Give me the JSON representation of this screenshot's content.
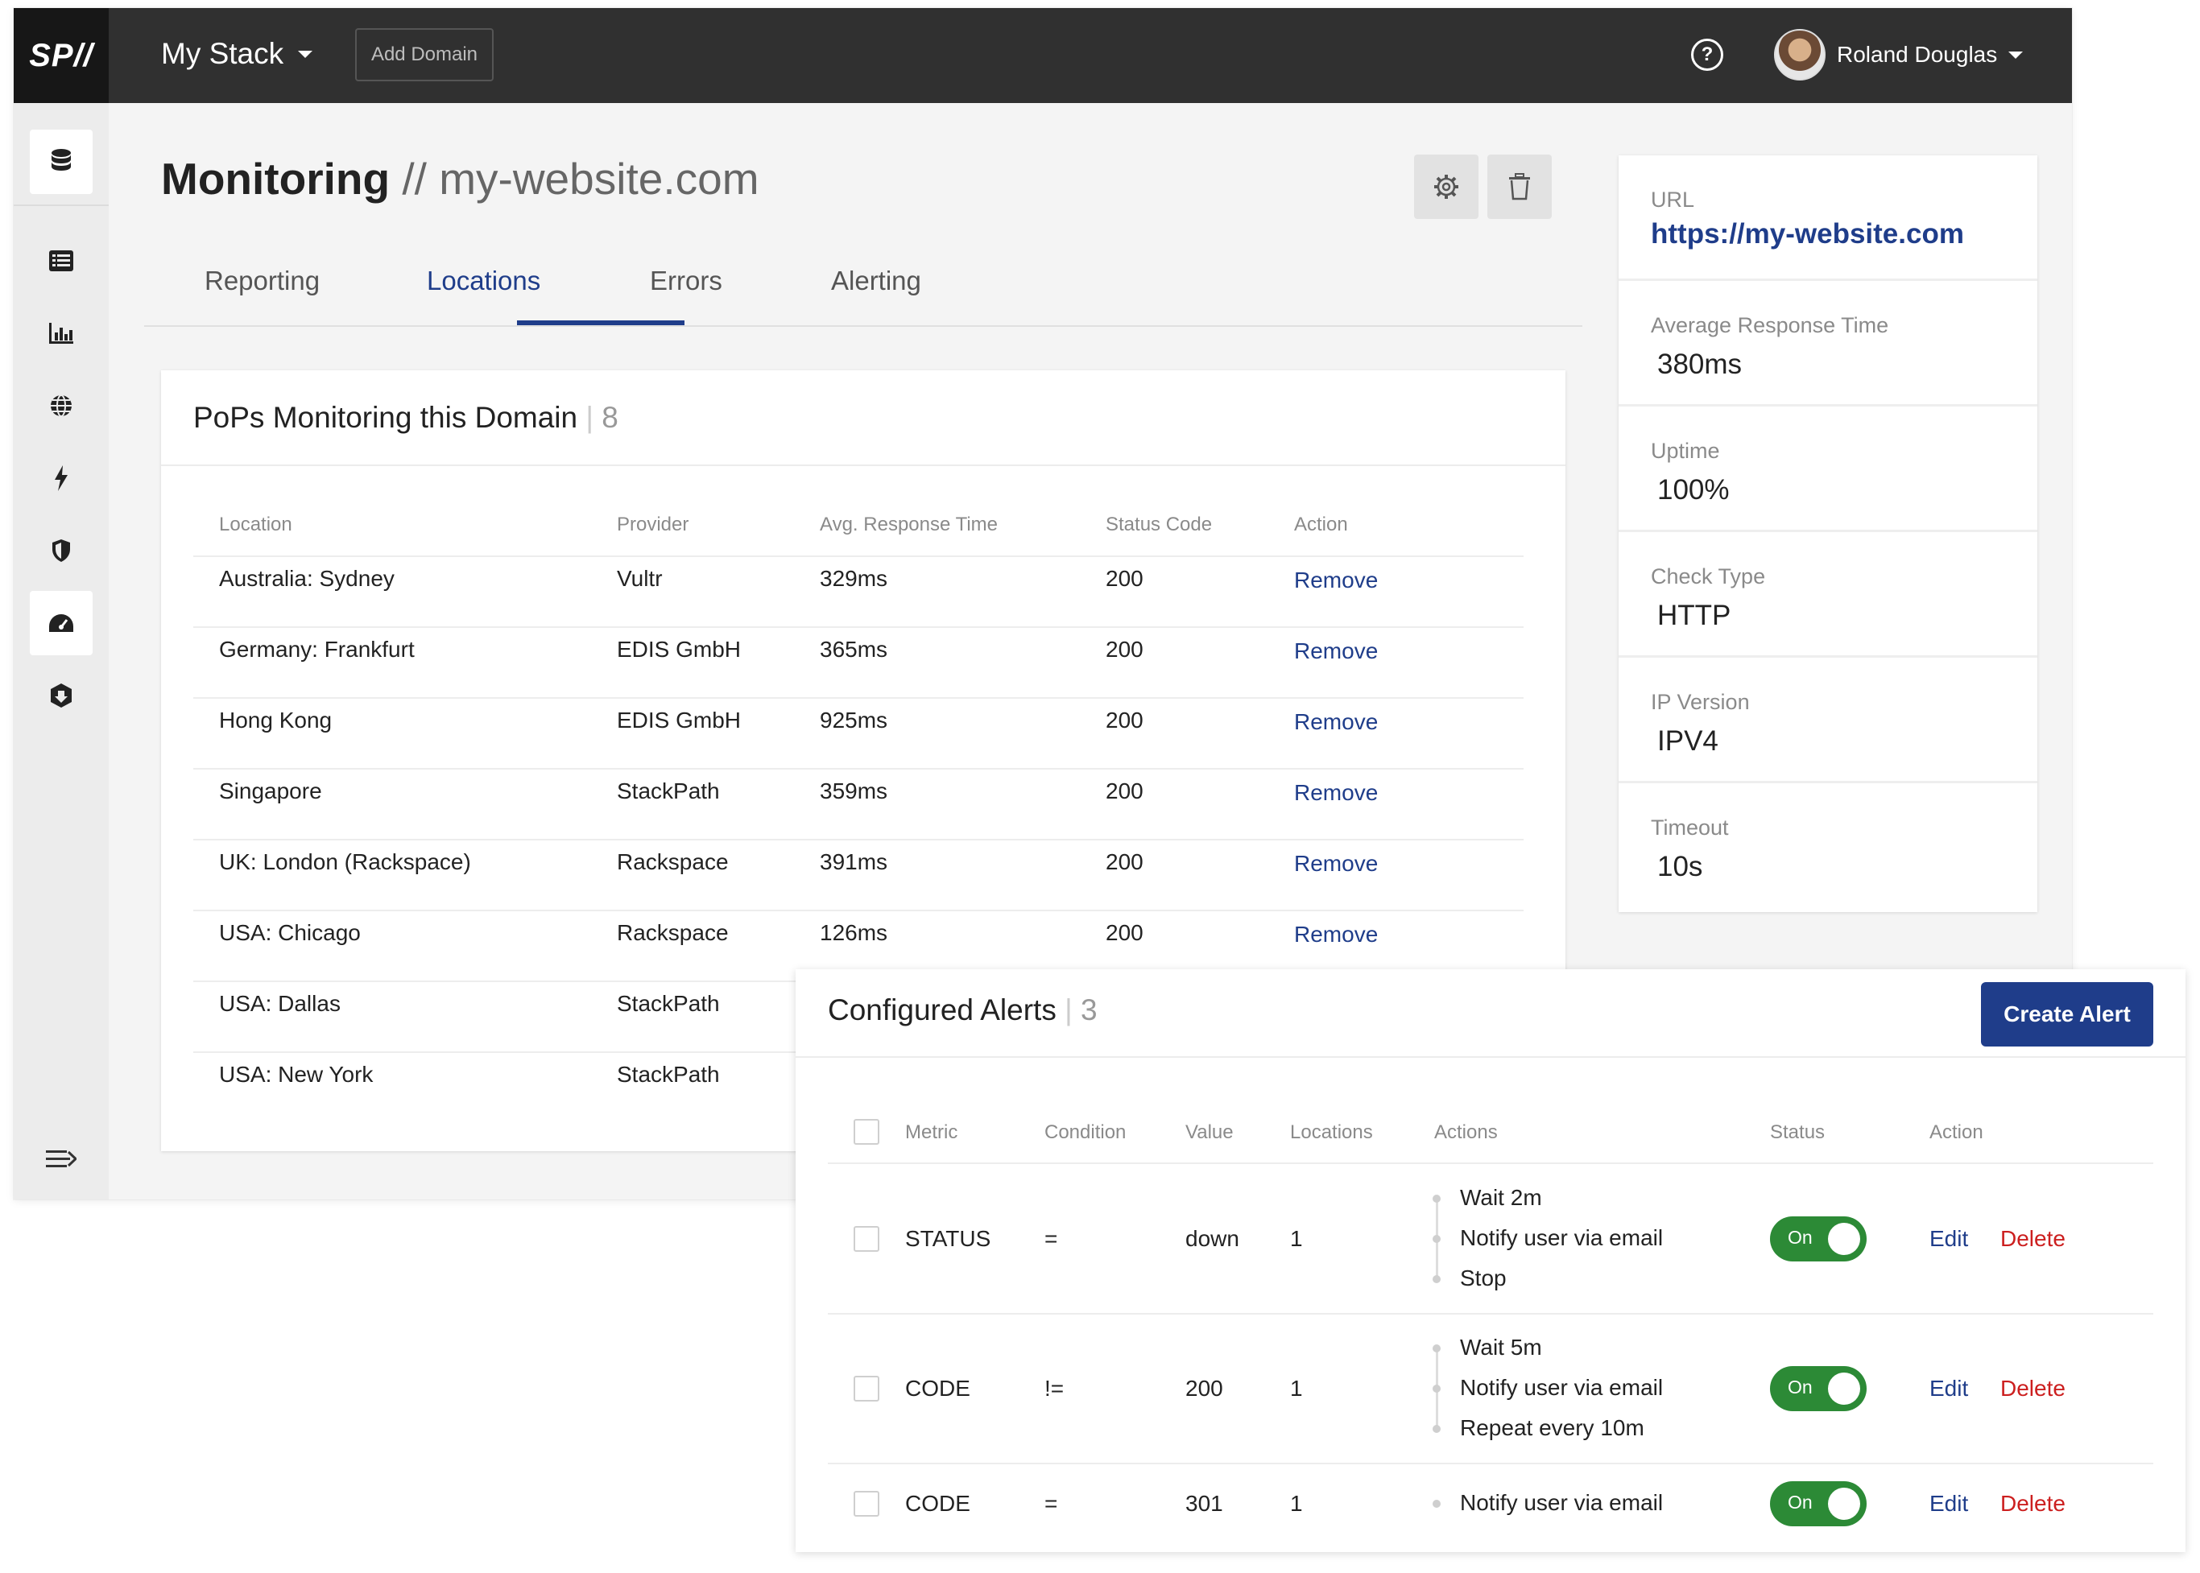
{
  "topbar": {
    "logo": "SP//",
    "stack_name": "My Stack",
    "add_domain": "Add Domain",
    "help": "?",
    "user_name": "Roland Douglas"
  },
  "page": {
    "title": "Monitoring",
    "separator": "//",
    "domain": "my-website.com"
  },
  "tabs": [
    "Reporting",
    "Locations",
    "Errors",
    "Alerting"
  ],
  "active_tab": "Locations",
  "pops": {
    "title": "PoPs Monitoring this Domain",
    "count": "8",
    "columns": [
      "Location",
      "Provider",
      "Avg. Response Time",
      "Status Code",
      "Action"
    ],
    "rows": [
      {
        "location": "Australia: Sydney",
        "provider": "Vultr",
        "time": "329ms",
        "code": "200",
        "action": "Remove"
      },
      {
        "location": "Germany: Frankfurt",
        "provider": "EDIS GmbH",
        "time": "365ms",
        "code": "200",
        "action": "Remove"
      },
      {
        "location": "Hong Kong",
        "provider": "EDIS GmbH",
        "time": "925ms",
        "code": "200",
        "action": "Remove"
      },
      {
        "location": "Singapore",
        "provider": "StackPath",
        "time": "359ms",
        "code": "200",
        "action": "Remove"
      },
      {
        "location": "UK: London (Rackspace)",
        "provider": "Rackspace",
        "time": "391ms",
        "code": "200",
        "action": "Remove"
      },
      {
        "location": "USA: Chicago",
        "provider": "Rackspace",
        "time": "126ms",
        "code": "200",
        "action": "Remove"
      },
      {
        "location": "USA: Dallas",
        "provider": "StackPath"
      },
      {
        "location": "USA: New York",
        "provider": "StackPath"
      }
    ]
  },
  "info": [
    {
      "label": "URL",
      "value": "https://my-website.com"
    },
    {
      "label": "Average Response Time",
      "value": "380ms"
    },
    {
      "label": "Uptime",
      "value": "100%"
    },
    {
      "label": "Check Type",
      "value": "HTTP"
    },
    {
      "label": "IP Version",
      "value": "IPV4"
    },
    {
      "label": "Timeout",
      "value": "10s"
    }
  ],
  "alerts": {
    "title": "Configured Alerts",
    "count": "3",
    "create_button": "Create Alert",
    "columns": [
      "Metric",
      "Condition",
      "Value",
      "Locations",
      "Actions",
      "Status",
      "Action"
    ],
    "rows": [
      {
        "metric": "STATUS",
        "condition": "=",
        "value": "down",
        "locations": "1",
        "actions": [
          "Wait 2m",
          "Notify user via email",
          "Stop"
        ],
        "status": "On",
        "edit": "Edit",
        "delete": "Delete"
      },
      {
        "metric": "CODE",
        "condition": "!=",
        "value": "200",
        "locations": "1",
        "actions": [
          "Wait 5m",
          "Notify user via email",
          "Repeat every 10m"
        ],
        "status": "On",
        "edit": "Edit",
        "delete": "Delete"
      },
      {
        "metric": "CODE",
        "condition": "=",
        "value": "301",
        "locations": "1",
        "actions": [
          "Notify user via email"
        ],
        "status": "On",
        "edit": "Edit",
        "delete": "Delete"
      }
    ]
  },
  "colors": {
    "accent": "#1f3d8a",
    "topbar": "#303030",
    "toggle_on": "#2c8a36",
    "danger": "#cc1f1f"
  },
  "sidebar_icons": [
    "database-icon",
    "list-icon",
    "bar-chart-icon",
    "globe-icon",
    "lightning-icon",
    "shield-icon",
    "speedometer-icon",
    "download-shield-icon",
    "expand-menu-icon"
  ]
}
